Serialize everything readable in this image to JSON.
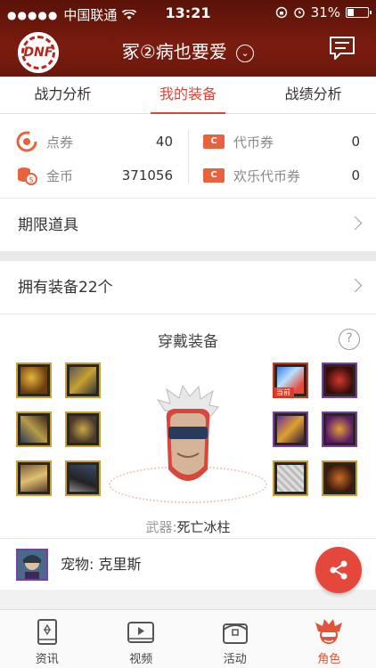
{
  "status_bar": {
    "carrier": "中国联通",
    "time": "13:21",
    "battery": "31%",
    "battery_level": 0.31
  },
  "nav": {
    "title": "冢②病也要爱",
    "title_chevron": "⌄",
    "logo_text": "DNF"
  },
  "tabs": [
    {
      "label": "战力分析",
      "active": false
    },
    {
      "label": "我的装备",
      "active": true
    },
    {
      "label": "战绩分析",
      "active": false
    }
  ],
  "currency": {
    "left": [
      {
        "icon": "dian-quan-icon",
        "label": "点券",
        "value": "40"
      },
      {
        "icon": "gold-coin-icon",
        "label": "金币",
        "value": "371056"
      }
    ],
    "right": [
      {
        "icon": "coupon-icon",
        "label": "代币券",
        "value": "0"
      },
      {
        "icon": "coupon-icon",
        "label": "欢乐代币券",
        "value": "0"
      }
    ],
    "coupon_glyph": "C"
  },
  "limited_items": {
    "label": "期限道具"
  },
  "owned_equipment": {
    "label": "拥有装备22个"
  },
  "worn_equipment": {
    "title": "穿戴装备",
    "help_glyph": "?",
    "current_badge": "当前",
    "weapon_label": "武器:",
    "weapon_name": "死亡冰柱"
  },
  "pet": {
    "label": "宠物:",
    "name": "克里斯"
  },
  "bottom_nav": [
    {
      "label": "资讯",
      "icon": "news-book-icon",
      "active": false
    },
    {
      "label": "视频",
      "icon": "video-play-icon",
      "active": false
    },
    {
      "label": "活动",
      "icon": "activity-chest-icon",
      "active": false
    },
    {
      "label": "角色",
      "icon": "character-icon",
      "active": true
    }
  ],
  "colors": {
    "header_bg": "#6b180c",
    "accent": "#d9463a",
    "coupon": "#e8623d",
    "share_button": "#e5473b"
  }
}
